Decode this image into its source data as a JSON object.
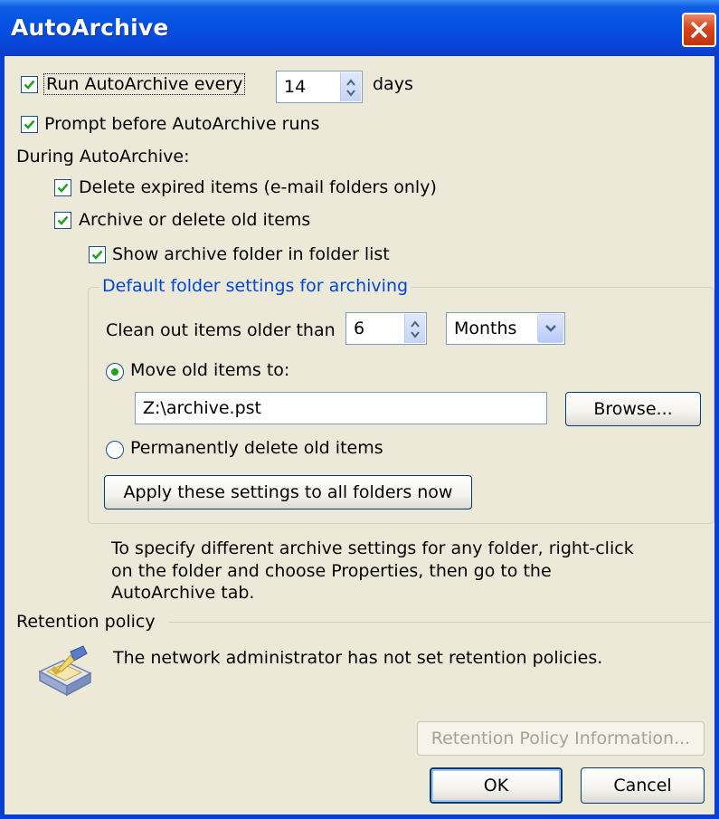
{
  "window": {
    "title": "AutoArchive"
  },
  "run_autoarchive": {
    "label": "Run AutoArchive every",
    "checked": true,
    "days_value": "14",
    "days_unit": "days"
  },
  "prompt_before": {
    "label": "Prompt before AutoArchive runs",
    "checked": true
  },
  "during_label": "During AutoArchive:",
  "delete_expired": {
    "label": "Delete expired items (e-mail folders only)",
    "checked": true
  },
  "archive_old": {
    "label": "Archive or delete old items",
    "checked": true
  },
  "show_archive_folder": {
    "label": "Show archive folder in folder list",
    "checked": true
  },
  "default_settings": {
    "group_title": "Default folder settings for archiving",
    "clean_out_label": "Clean out items older than",
    "clean_out_value": "6",
    "clean_out_unit": "Months",
    "move_label": "Move old items to:",
    "move_selected": true,
    "archive_path": "Z:\\archive.pst",
    "browse_label": "Browse...",
    "delete_label": "Permanently delete old items",
    "apply_label": "Apply these settings to all folders now"
  },
  "info_text_lines": [
    "To specify different archive settings for any folder, right-click",
    "on the folder and choose Properties, then go to the",
    "AutoArchive tab."
  ],
  "retention": {
    "label": "Retention policy",
    "message": "The network administrator has not set retention policies.",
    "info_button": "Retention Policy Information..."
  },
  "buttons": {
    "ok": "OK",
    "cancel": "Cancel"
  },
  "colors": {
    "title_bar": "#0a46d8",
    "dialog_bg": "#ece9d8",
    "group_title": "#0046d5",
    "check_mark": "#21a121",
    "close_button": "#d8441c"
  },
  "icons": {
    "close": "close-icon",
    "check": "checkmark-icon",
    "spin": "spin-arrows-icon",
    "dropdown": "chevron-down-icon",
    "retention": "retention-policy-icon"
  }
}
